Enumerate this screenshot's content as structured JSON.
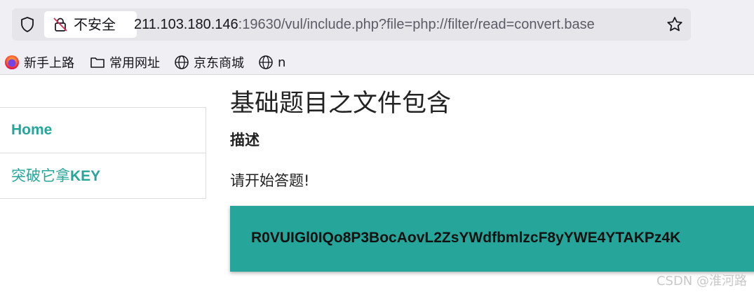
{
  "browser": {
    "identity_label": "不安全",
    "url_host": "211.103.180.146",
    "url_rest": ":19630/vul/include.php?file=php://filter/read=convert.base"
  },
  "bookmarks": [
    {
      "label": "新手上路",
      "icon": "firefox-icon"
    },
    {
      "label": "常用网址",
      "icon": "folder-icon"
    },
    {
      "label": "京东商城",
      "icon": "globe-icon"
    },
    {
      "label": "n",
      "icon": "globe-icon"
    }
  ],
  "sidebar": {
    "items": [
      {
        "label": "Home"
      },
      {
        "label_cjk": "突破它拿",
        "label_latin": "KEY"
      }
    ]
  },
  "main": {
    "title": "基础题目之文件包含",
    "subhead": "描述",
    "prompt": "请开始答题!"
  },
  "key": {
    "value": "R0VUIGl0IQo8P3BocAovL2ZsYWdfbmlzcF8yYWE4YTAKPz4K"
  },
  "watermark": "CSDN @淮河路",
  "colors": {
    "accent": "#26a69a"
  }
}
